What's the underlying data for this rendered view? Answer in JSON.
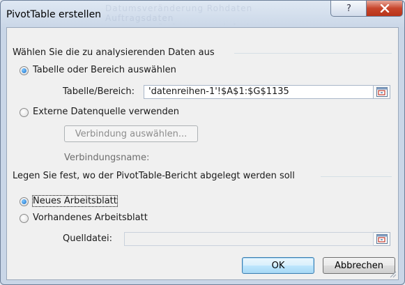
{
  "dialog": {
    "title": "PivotTable erstellen",
    "watermark": "Datumsveränderung  Rohdaten  Auftragsdaten  Datumsveränderung  Aptiefzeit"
  },
  "section_data": {
    "heading": "Wählen Sie die zu analysierenden Daten aus",
    "radio_table_label": "Tabelle oder Bereich auswählen",
    "table_range_label": "Tabelle/Bereich:",
    "table_range_value": "'datenreihen-1'!$A$1:$G$1135",
    "radio_external_label": "Externe Datenquelle verwenden",
    "choose_connection_button": "Verbindung auswählen...",
    "connection_name_label": "Verbindungsname:"
  },
  "section_location": {
    "heading": "Legen Sie fest, wo der PivotTable-Bericht abgelegt werden soll",
    "radio_new_sheet_label": "Neues Arbeitsblatt",
    "radio_existing_sheet_label": "Vorhandenes Arbeitsblatt",
    "source_file_label": "Quelldatei:",
    "source_file_value": ""
  },
  "buttons": {
    "ok": "OK",
    "cancel": "Abbrechen",
    "help": "?"
  },
  "state": {
    "data_source": "Tabelle oder Bereich auswählen",
    "location": "Neues Arbeitsblatt"
  }
}
